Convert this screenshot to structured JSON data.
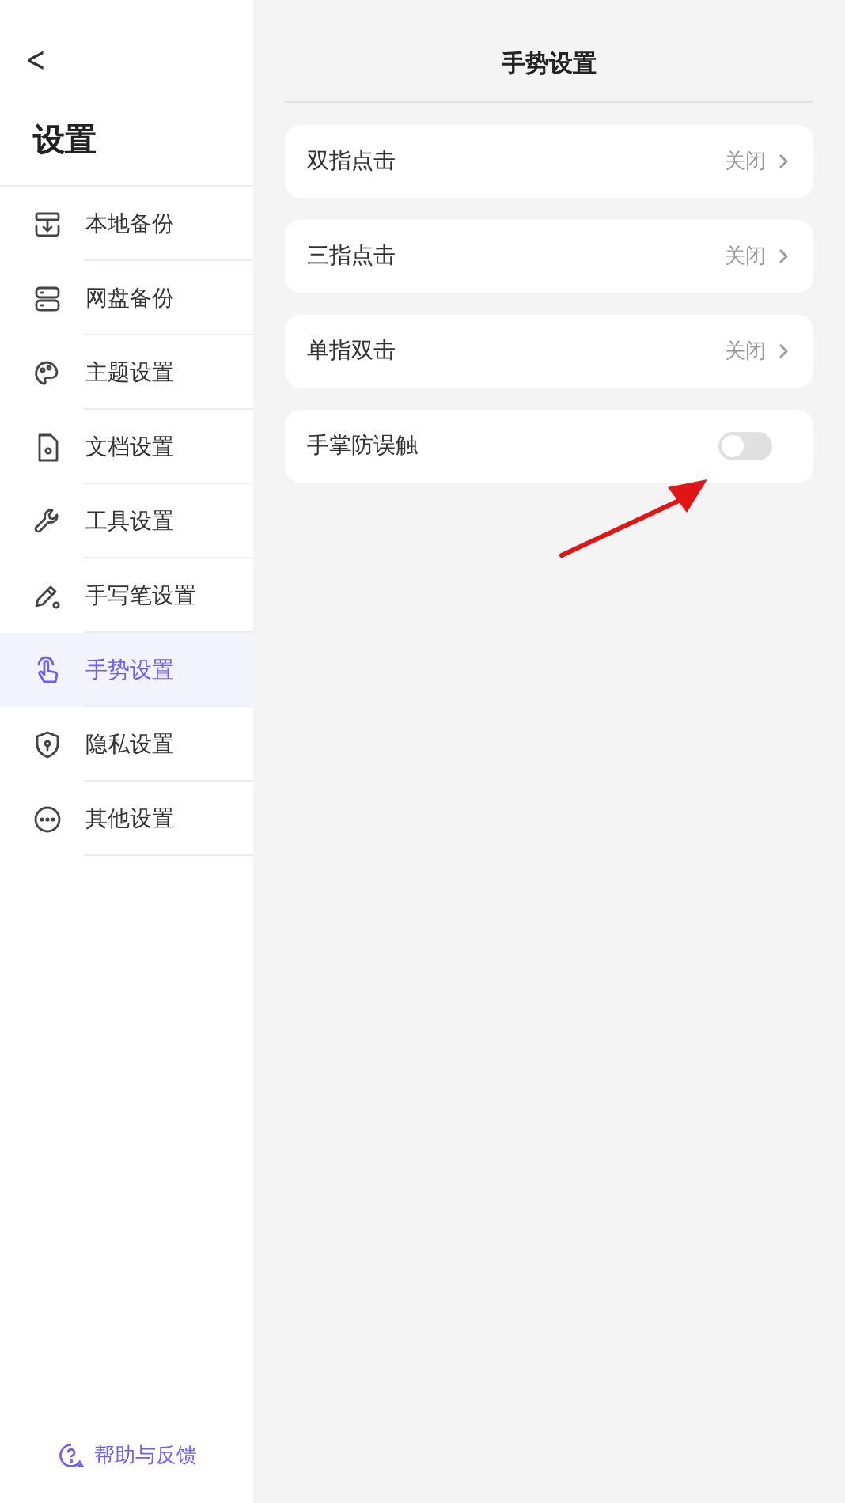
{
  "sidebar": {
    "back": "<",
    "title": "设置",
    "items": [
      {
        "label": "本地备份",
        "selected": false
      },
      {
        "label": "网盘备份",
        "selected": false
      },
      {
        "label": "主题设置",
        "selected": false
      },
      {
        "label": "文档设置",
        "selected": false
      },
      {
        "label": "工具设置",
        "selected": false
      },
      {
        "label": "手写笔设置",
        "selected": false
      },
      {
        "label": "手势设置",
        "selected": true
      },
      {
        "label": "隐私设置",
        "selected": false
      },
      {
        "label": "其他设置",
        "selected": false
      }
    ],
    "help": "帮助与反馈"
  },
  "main": {
    "title": "手势设置",
    "rows": [
      {
        "kind": "link",
        "label": "双指点击",
        "value": "关闭"
      },
      {
        "kind": "link",
        "label": "三指点击",
        "value": "关闭"
      },
      {
        "kind": "link",
        "label": "单指双击",
        "value": "关闭"
      },
      {
        "kind": "toggle",
        "label": "手掌防误触",
        "on": false
      }
    ]
  }
}
